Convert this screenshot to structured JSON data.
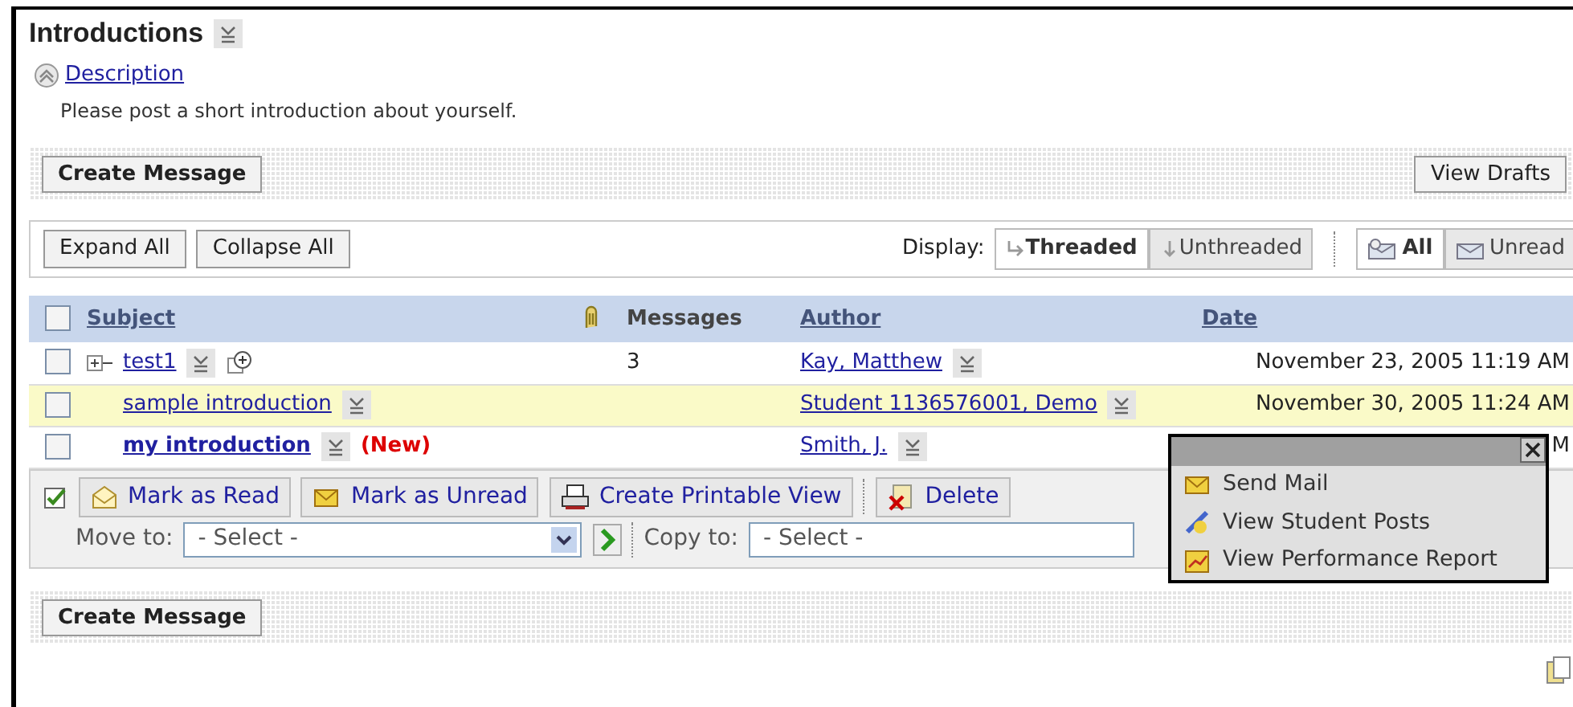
{
  "title": "Introductions",
  "description": {
    "link": "Description",
    "expanded": true,
    "text": "Please post a short introduction about yourself."
  },
  "top_toolbar": {
    "create_button": "Create Message",
    "drafts_button": "View Drafts"
  },
  "filter_bar": {
    "expand_button": "Expand All",
    "collapse_button": "Collapse All",
    "display_label": "Display:",
    "display_options": [
      {
        "label": "Threaded",
        "selected": true
      },
      {
        "label": "Unthreaded",
        "selected": false
      }
    ],
    "read_filters": [
      {
        "label": "All",
        "selected": true
      },
      {
        "label": "Unread",
        "selected": false
      }
    ]
  },
  "table": {
    "select_all_checked": false,
    "columns": [
      "Subject",
      "Messages",
      "Author",
      "Date"
    ],
    "rows": [
      {
        "subject": "test1",
        "has_children": true,
        "messages": "3",
        "author": "Kay, Matthew",
        "date": "November 23, 2005 11:19 AM",
        "checked": false,
        "highlighted": false,
        "unread": false
      },
      {
        "subject": "sample introduction",
        "has_children": false,
        "author": "Student 1136576001, Demo",
        "date": "November 30, 2005 11:24 AM",
        "checked": false,
        "highlighted": true,
        "unread": false
      },
      {
        "subject": "my introduction",
        "has_children": false,
        "new_label": "(New)",
        "author": "Smith, J.",
        "date": "M",
        "checked": false,
        "highlighted": false,
        "unread": true
      }
    ]
  },
  "actions": {
    "select_checked": true,
    "buttons": [
      {
        "label": "Mark as Read",
        "kind": "read"
      },
      {
        "label": "Mark as Unread",
        "kind": "unread"
      },
      {
        "label": "Create Printable View",
        "kind": "print"
      },
      {
        "label": "Delete",
        "kind": "delete"
      }
    ],
    "move_label": "Move to:",
    "move_value": "- Select -",
    "copy_label": "Copy to:",
    "copy_value": "- Select -"
  },
  "context_menu": {
    "items": [
      {
        "label": "Send Mail",
        "kind": "mail"
      },
      {
        "label": "View Student Posts",
        "kind": "posts"
      },
      {
        "label": "View Performance Report",
        "kind": "report"
      }
    ]
  },
  "bottom_toolbar": {
    "create_button": "Create Message"
  }
}
